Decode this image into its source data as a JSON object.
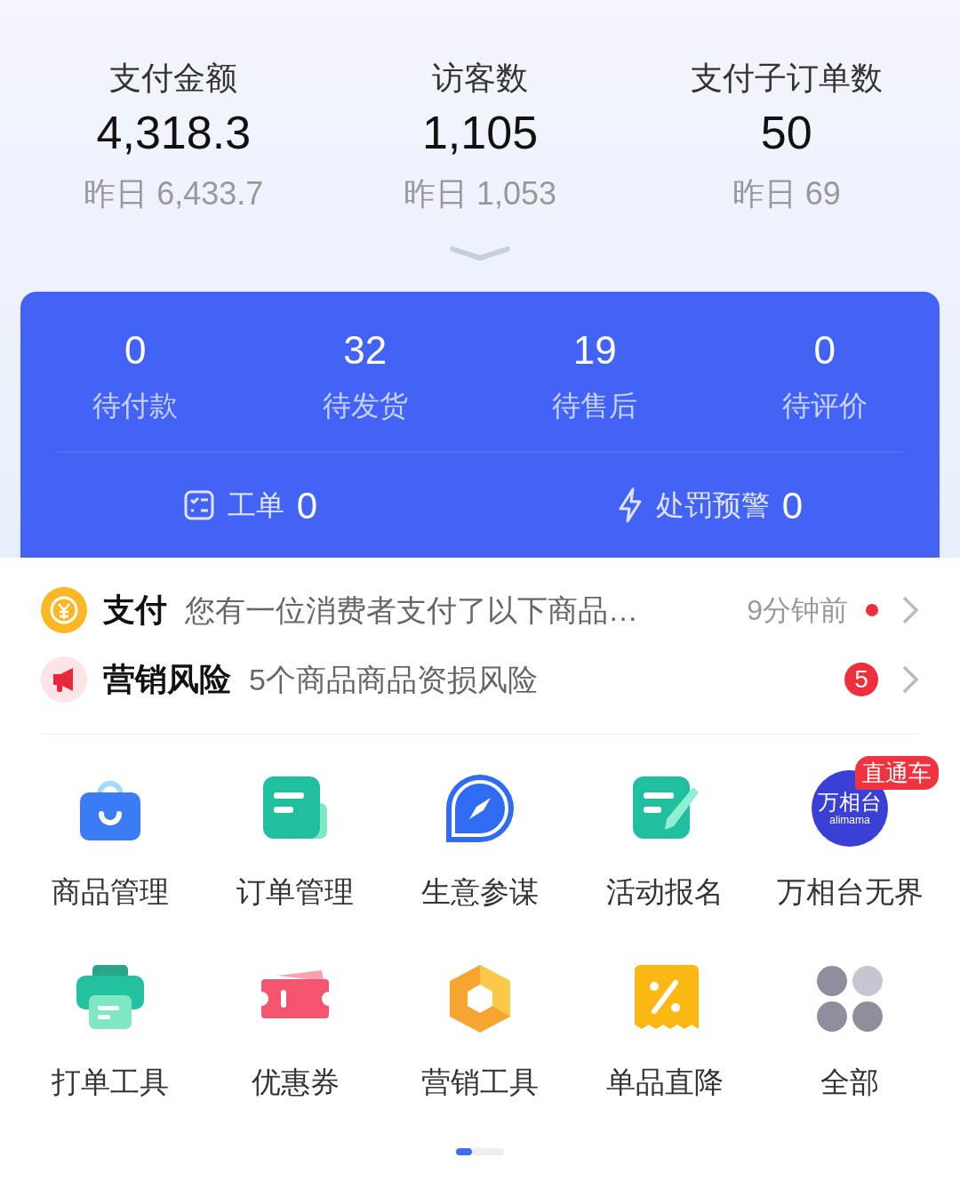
{
  "stats": [
    {
      "label": "支付金额",
      "value": "4,318.3",
      "yesterday": "昨日 6,433.7"
    },
    {
      "label": "访客数",
      "value": "1,105",
      "yesterday": "昨日 1,053"
    },
    {
      "label": "支付子订单数",
      "value": "50",
      "yesterday": "昨日 69"
    }
  ],
  "orders": [
    {
      "count": "0",
      "label": "待付款"
    },
    {
      "count": "32",
      "label": "待发货"
    },
    {
      "count": "19",
      "label": "待售后"
    },
    {
      "count": "0",
      "label": "待评价"
    }
  ],
  "order_footer": [
    {
      "kind": "ticket",
      "label": "工单",
      "count": "0"
    },
    {
      "kind": "bolt",
      "label": "处罚预警",
      "count": "0"
    }
  ],
  "notices": [
    {
      "kind": "payment",
      "title": "支付",
      "text": "您有一位消费者支付了以下商品…",
      "time": "9分钟前",
      "unread": true
    },
    {
      "kind": "risk",
      "title": "营销风险",
      "text": "5个商品商品资损风险",
      "badge": "5"
    }
  ],
  "tools": [
    {
      "kind": "bag",
      "label": "商品管理"
    },
    {
      "kind": "doc",
      "label": "订单管理"
    },
    {
      "kind": "compass",
      "label": "生意参谋"
    },
    {
      "kind": "form",
      "label": "活动报名"
    },
    {
      "kind": "logo",
      "label": "万相台无界",
      "logo_text": "万相台",
      "logo_sub": "alimama",
      "tag": "直通车"
    },
    {
      "kind": "printer",
      "label": "打单工具"
    },
    {
      "kind": "coupon",
      "label": "优惠券"
    },
    {
      "kind": "hexagon",
      "label": "营销工具"
    },
    {
      "kind": "discount",
      "label": "单品直降"
    },
    {
      "kind": "grid",
      "label": "全部"
    }
  ],
  "pager": [
    {
      "selected": true
    },
    {
      "selected": false
    }
  ]
}
